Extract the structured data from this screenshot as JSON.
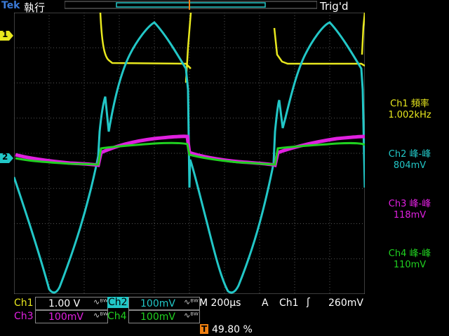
{
  "top": {
    "brand": "Tek",
    "mode": "執行",
    "trigger_state": "Trig'd",
    "trigger_marker": "T"
  },
  "markers": {
    "ch1": "1",
    "ch2": "2",
    "trigger_level_arrow": "◀"
  },
  "measurements": [
    {
      "label": "Ch1 頻率",
      "value": "1.002kHz",
      "color": "#e8e81e"
    },
    {
      "label": "Ch2 峰-峰",
      "value": "804mV",
      "color": "#22c7c7"
    },
    {
      "label": "Ch3 峰-峰",
      "value": "118mV",
      "color": "#e020e0"
    },
    {
      "label": "Ch4 峰-峰",
      "value": "110mV",
      "color": "#20d020"
    }
  ],
  "bottom": {
    "ch1_name": "Ch1",
    "ch1_scale": "1.00 V",
    "ch2_name": "Ch2",
    "ch2_scale": "100mV",
    "ch3_name": "Ch3",
    "ch3_scale": "100mV",
    "ch4_name": "Ch4",
    "ch4_scale": "100mV",
    "bw_symbol": "ᴮᵂ",
    "timebase": "M 200µs",
    "acq": "A",
    "trig_source": "Ch1",
    "trig_slope": "ʃ",
    "trig_level": "260mV",
    "trig_pos_marker": "T",
    "trig_position": "49.80 %"
  },
  "colors": {
    "ch1": "#e8e81e",
    "ch2": "#22c7c7",
    "ch3": "#e020e0",
    "ch4": "#20d020",
    "grid": "#555555",
    "trigger_orange": "#f08010"
  }
}
